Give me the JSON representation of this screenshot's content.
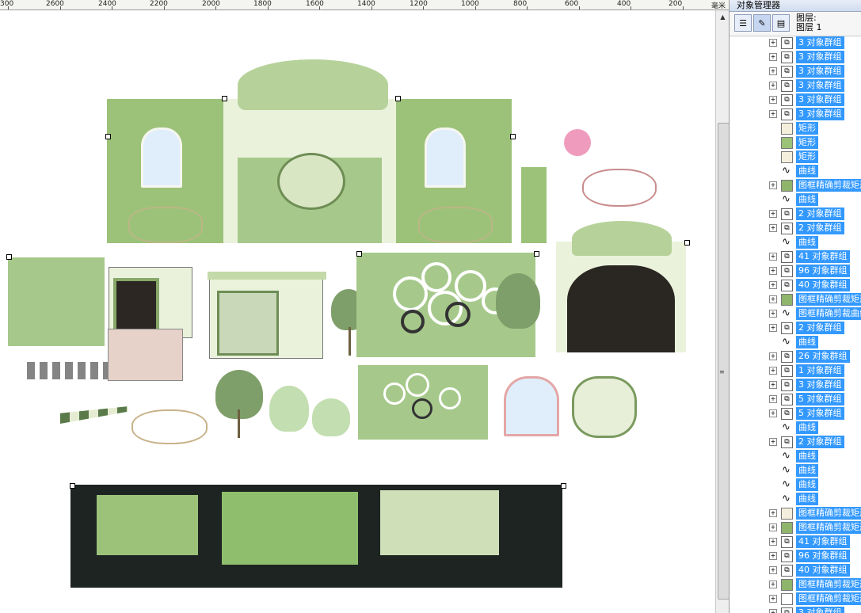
{
  "ruler": {
    "labels": [
      "300",
      "2600",
      "2400",
      "2200",
      "2000",
      "1800",
      "1600",
      "1400",
      "1200",
      "1000",
      "800",
      "600",
      "400",
      "200"
    ],
    "unit": "毫米"
  },
  "panel": {
    "title": "对象管理器",
    "page_name": "图层:",
    "layer_name": "图层 1"
  },
  "tree_rows": [
    {
      "type": "group",
      "expand": true,
      "label": "3 对象群组"
    },
    {
      "type": "group",
      "expand": true,
      "label": "3 对象群组"
    },
    {
      "type": "group",
      "expand": true,
      "label": "3 对象群组"
    },
    {
      "type": "group",
      "expand": true,
      "label": "3 对象群组"
    },
    {
      "type": "group",
      "expand": true,
      "label": "3 对象群组"
    },
    {
      "type": "group",
      "expand": true,
      "label": "3 对象群组"
    },
    {
      "type": "rect",
      "expand": false,
      "swatch": "#f3efdc",
      "label": "矩形"
    },
    {
      "type": "rect",
      "expand": false,
      "swatch": "#9cc27a",
      "label": "矩形"
    },
    {
      "type": "rect",
      "expand": false,
      "swatch": "#f3efdc",
      "label": "矩形"
    },
    {
      "type": "curve",
      "expand": false,
      "label": "曲线"
    },
    {
      "type": "rect",
      "expand": true,
      "swatch": "#8fb46c",
      "label": "图框精确剪裁矩形"
    },
    {
      "type": "curve",
      "expand": false,
      "label": "曲线"
    },
    {
      "type": "group",
      "expand": true,
      "label": "2 对象群组"
    },
    {
      "type": "group",
      "expand": true,
      "label": "2 对象群组"
    },
    {
      "type": "curve",
      "expand": false,
      "label": "曲线"
    },
    {
      "type": "group",
      "expand": true,
      "label": "41 对象群组"
    },
    {
      "type": "group",
      "expand": true,
      "label": "96 对象群组"
    },
    {
      "type": "group",
      "expand": true,
      "label": "40 对象群组"
    },
    {
      "type": "rect",
      "expand": true,
      "swatch": "#8fb46c",
      "label": "图框精确剪裁矩形"
    },
    {
      "type": "curve",
      "expand": true,
      "label": "图框精确剪裁曲线"
    },
    {
      "type": "group",
      "expand": true,
      "label": "2 对象群组"
    },
    {
      "type": "curve",
      "expand": false,
      "label": "曲线"
    },
    {
      "type": "group",
      "expand": true,
      "label": "26 对象群组"
    },
    {
      "type": "group",
      "expand": true,
      "label": "1 对象群组"
    },
    {
      "type": "group",
      "expand": true,
      "label": "3 对象群组"
    },
    {
      "type": "group",
      "expand": true,
      "label": "5 对象群组"
    },
    {
      "type": "group",
      "expand": true,
      "label": "5 对象群组"
    },
    {
      "type": "curve",
      "expand": false,
      "label": "曲线"
    },
    {
      "type": "group",
      "expand": true,
      "label": "2 对象群组"
    },
    {
      "type": "curve",
      "expand": false,
      "label": "曲线"
    },
    {
      "type": "curve",
      "expand": false,
      "label": "曲线"
    },
    {
      "type": "curve",
      "expand": false,
      "label": "曲线"
    },
    {
      "type": "curve",
      "expand": false,
      "label": "曲线"
    },
    {
      "type": "rect",
      "expand": true,
      "swatch": "#f3efdc",
      "label": "图框精确剪裁矩形"
    },
    {
      "type": "rect",
      "expand": true,
      "swatch": "#8fb46c",
      "label": "图框精确剪裁矩形"
    },
    {
      "type": "group",
      "expand": true,
      "label": "41 对象群组"
    },
    {
      "type": "group",
      "expand": true,
      "label": "96 对象群组"
    },
    {
      "type": "group",
      "expand": true,
      "label": "40 对象群组"
    },
    {
      "type": "rect",
      "expand": true,
      "swatch": "#8fb46c",
      "label": "图框精确剪裁矩形"
    },
    {
      "type": "rect",
      "expand": true,
      "swatch": "#ffffff",
      "label": "图框精确剪裁矩形"
    },
    {
      "type": "group",
      "expand": true,
      "label": "3 对象群组"
    }
  ],
  "colors": {
    "selection": "#3399ff",
    "wall_green": "#9cc27a",
    "dark_stage": "#1e2422"
  }
}
